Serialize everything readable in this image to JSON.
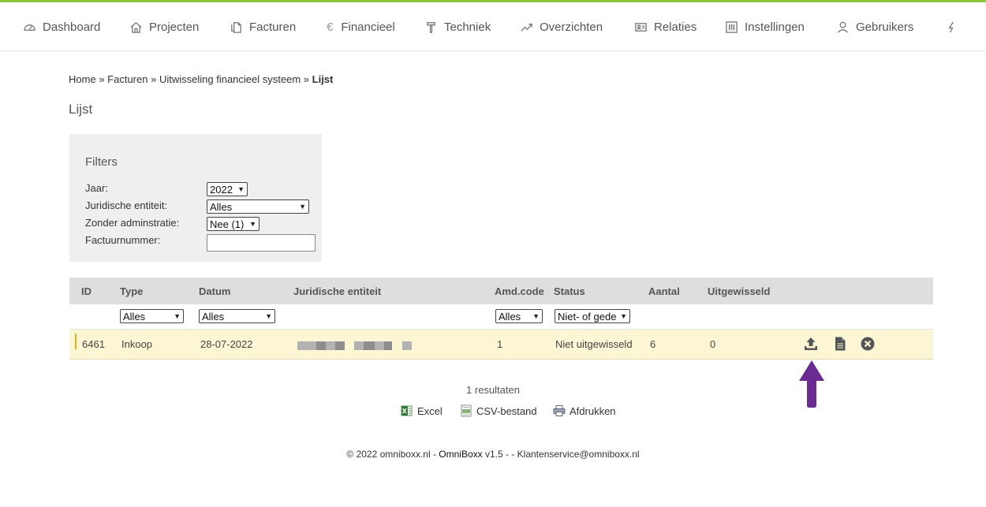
{
  "nav": {
    "items": [
      {
        "label": "Dashboard",
        "icon": "dashboard-gauge-icon"
      },
      {
        "label": "Projecten",
        "icon": "home-icon"
      },
      {
        "label": "Facturen",
        "icon": "documents-icon"
      },
      {
        "label": "Financieel",
        "icon": "euro-icon"
      },
      {
        "label": "Techniek",
        "icon": "hammer-icon"
      },
      {
        "label": "Overzichten",
        "icon": "line-chart-icon"
      },
      {
        "label": "Relaties",
        "icon": "contact-card-icon"
      },
      {
        "label": "Instellingen",
        "icon": "sliders-icon"
      },
      {
        "label": "Gebruikers",
        "icon": "user-icon"
      }
    ],
    "euro_symbol": "€",
    "accent_color": "#8cc63e"
  },
  "breadcrumb": {
    "items": [
      "Home",
      "Facturen",
      "Uitwisseling financieel systeem"
    ],
    "separator": "»",
    "current": "Lijst"
  },
  "page": {
    "title": "Lijst"
  },
  "filters": {
    "title": "Filters",
    "jaar": {
      "label": "Jaar:",
      "value": "2022"
    },
    "entiteit": {
      "label": "Juridische entiteit:",
      "value": "Alles"
    },
    "administratie": {
      "label": "Zonder adminstratie:",
      "value": "Nee (1)"
    },
    "factuurnummer": {
      "label": "Factuurnummer:",
      "value": ""
    }
  },
  "table": {
    "headers": [
      "ID",
      "Type",
      "Datum",
      "Juridische entiteit",
      "Amd.code",
      "Status",
      "Aantal",
      "Uitgewisseld"
    ],
    "column_filters": {
      "type": "Alles",
      "datum": "Alles",
      "amdcode": "Alles",
      "status": "Niet- of gede"
    },
    "rows": [
      {
        "id": "6461",
        "type": "Inkoop",
        "datum": "28-07-2022",
        "amdcode": "1",
        "status": "Niet uitgewisseld",
        "aantal": "6",
        "uitgewisseld": "0"
      }
    ],
    "row_actions": [
      "upload-icon",
      "document-icon",
      "delete-circle-icon"
    ],
    "highlight_color": "#fcf6d4",
    "annotation_arrow_color": "#6a2c91"
  },
  "results": {
    "text": "1 resultaten"
  },
  "exports": [
    {
      "label": "Excel",
      "icon": "excel-icon"
    },
    {
      "label": "CSV-bestand",
      "icon": "csv-icon"
    },
    {
      "label": "Afdrukken",
      "icon": "printer-icon"
    }
  ],
  "footer": {
    "copyright": "© 2022 omniboxx.nl - ",
    "brand": "OmniBoxx",
    "version": " v1.5 - - Klantenservice@omniboxx.nl"
  }
}
